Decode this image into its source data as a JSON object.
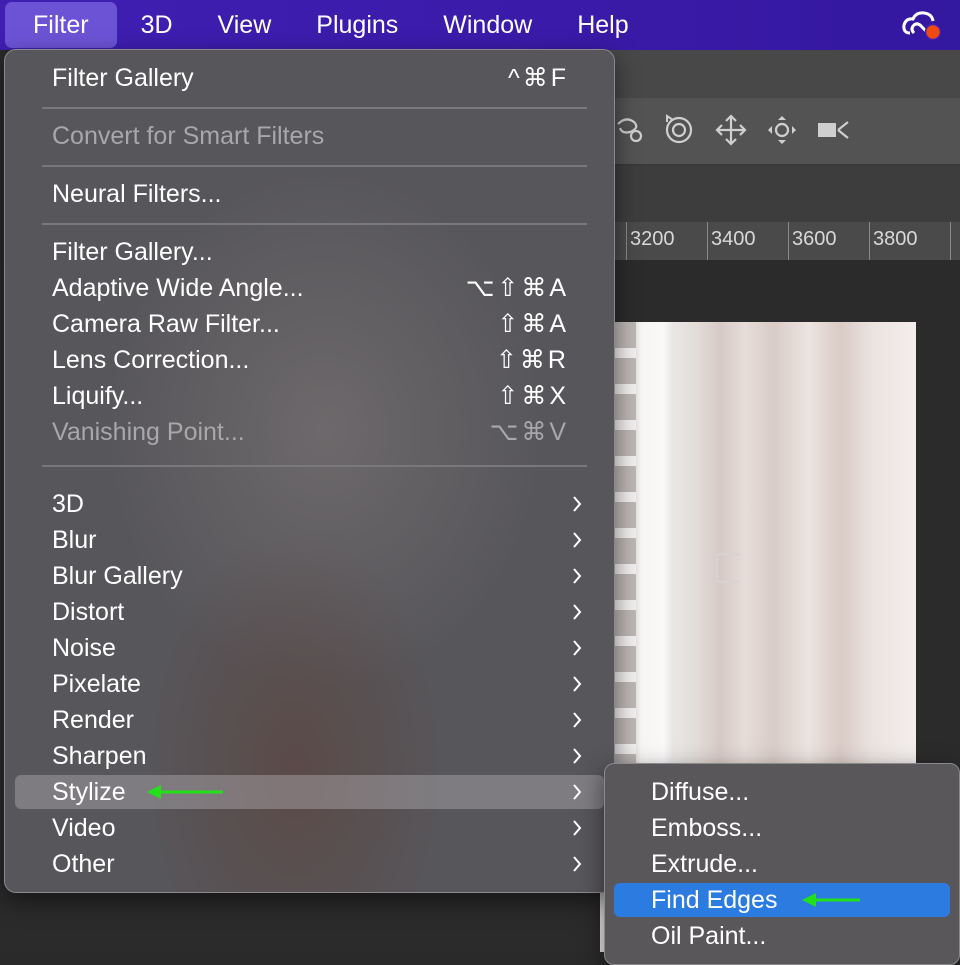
{
  "menubar": {
    "items": [
      {
        "label": "Filter",
        "active": true
      },
      {
        "label": "3D"
      },
      {
        "label": "View"
      },
      {
        "label": "Plugins"
      },
      {
        "label": "Window"
      },
      {
        "label": "Help"
      }
    ],
    "status_icon": "creative-cloud-icon"
  },
  "ruler": {
    "ticks": [
      "3200",
      "3400",
      "3600",
      "3800"
    ]
  },
  "filter_menu": {
    "top_items": [
      {
        "label": "Filter Gallery",
        "shortcut": "^⌘F"
      },
      {
        "label": "Convert for Smart Filters",
        "disabled": true
      },
      {
        "label": "Neural Filters..."
      }
    ],
    "filter_items": [
      {
        "label": "Filter Gallery..."
      },
      {
        "label": "Adaptive Wide Angle...",
        "shortcut": "⌥⇧⌘A"
      },
      {
        "label": "Camera Raw Filter...",
        "shortcut": "⇧⌘A"
      },
      {
        "label": "Lens Correction...",
        "shortcut": "⇧⌘R"
      },
      {
        "label": "Liquify...",
        "shortcut": "⇧⌘X"
      },
      {
        "label": "Vanishing Point...",
        "shortcut": "⌥⌘V",
        "disabled": true
      }
    ],
    "submenu_items": [
      {
        "label": "3D"
      },
      {
        "label": "Blur"
      },
      {
        "label": "Blur Gallery"
      },
      {
        "label": "Distort"
      },
      {
        "label": "Noise"
      },
      {
        "label": "Pixelate"
      },
      {
        "label": "Render"
      },
      {
        "label": "Sharpen"
      },
      {
        "label": "Stylize",
        "highlighted": true
      },
      {
        "label": "Video"
      },
      {
        "label": "Other"
      }
    ]
  },
  "stylize_submenu": {
    "items": [
      {
        "label": "Diffuse..."
      },
      {
        "label": "Emboss..."
      },
      {
        "label": "Extrude..."
      },
      {
        "label": "Find Edges",
        "selected": true
      },
      {
        "label": "Oil Paint..."
      }
    ]
  },
  "colors": {
    "menubar": "#3e1fb2",
    "active_menu": "#6c53d6",
    "selection": "#2b7be0",
    "annotation_arrow": "#22e01a"
  }
}
